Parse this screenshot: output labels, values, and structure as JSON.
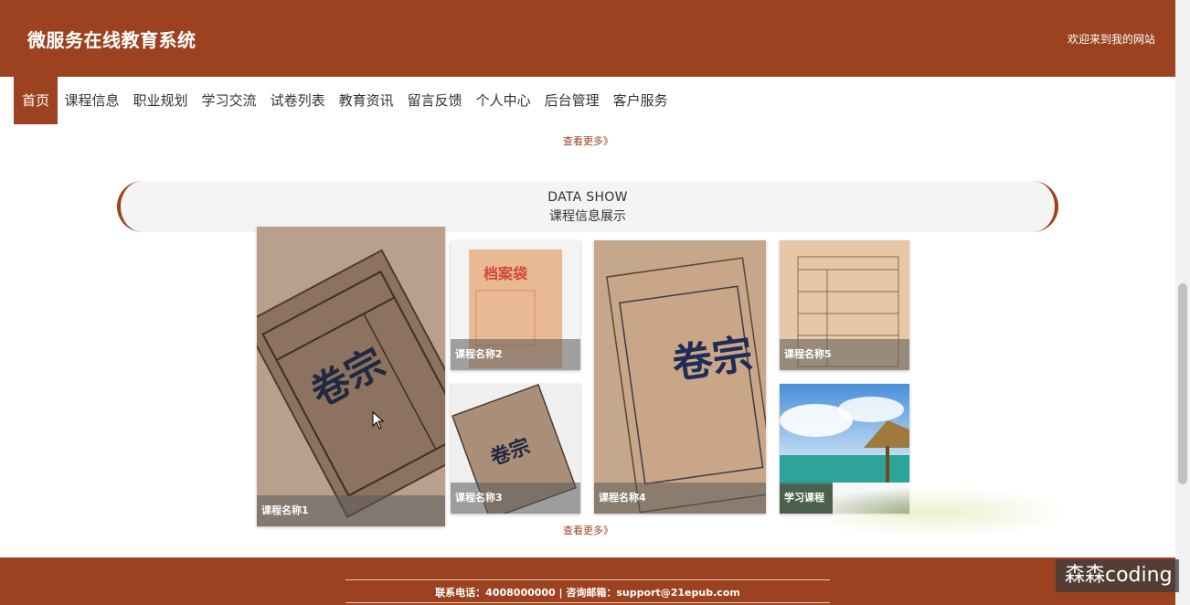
{
  "header": {
    "title": "微服务在线教育系统",
    "welcome": "欢迎来到我的网站"
  },
  "nav": {
    "items": [
      "首页",
      "课程信息",
      "职业规划",
      "学习交流",
      "试卷列表",
      "教育资讯",
      "留言反馈",
      "个人中心",
      "后台管理",
      "客户服务"
    ],
    "active": "首页"
  },
  "more_top": "查看更多》",
  "section": {
    "title_en": "DATA SHOW",
    "title_zh": "课程信息展示"
  },
  "cards": [
    "课程名称1",
    "课程名称2",
    "课程名称3",
    "课程名称4",
    "课程名称5",
    "学习课程"
  ],
  "more_bottom": "查看更多》",
  "footer": {
    "contact": "联系电话：4008000000 | 咨询邮箱：support@21epub.com"
  },
  "watermark": "森森coding",
  "colors": {
    "brand": "#9c4220",
    "banner_bg": "#f4f4f4"
  },
  "image_text": {
    "folder": "卷宗",
    "envelope": "档案袋"
  }
}
